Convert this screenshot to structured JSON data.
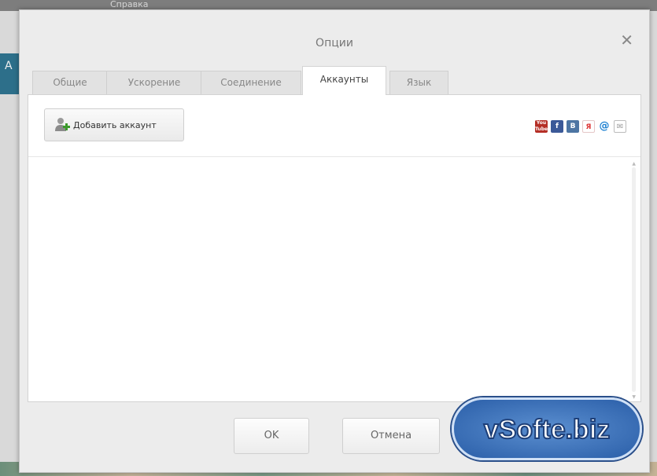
{
  "background": {
    "menu_item": "Справка",
    "side_label": "A"
  },
  "dialog": {
    "title": "Опции",
    "close_icon": "close-icon",
    "tabs": [
      {
        "label": "Общие"
      },
      {
        "label": "Ускорение"
      },
      {
        "label": "Соединение"
      },
      {
        "label": "Аккаунты",
        "active": true
      },
      {
        "label": "Язык"
      }
    ],
    "add_account_label": "Добавить аккаунт",
    "social_icons": [
      "youtube-icon",
      "facebook-icon",
      "vk-icon",
      "yandex-icon",
      "mail-at-icon",
      "email-icon"
    ],
    "ok_label": "OK",
    "cancel_label": "Отмена"
  },
  "watermark": "vSofte.biz"
}
